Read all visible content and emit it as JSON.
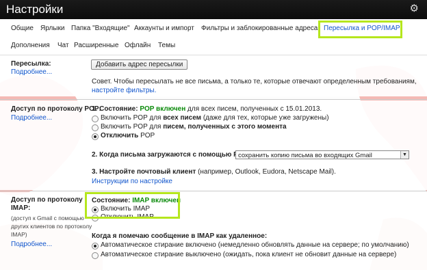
{
  "header": {
    "title": "Настройки",
    "gear_icon": "gear-icon"
  },
  "tabs": [
    {
      "label": "Общие"
    },
    {
      "label": "Ярлыки"
    },
    {
      "label": "Папка \"Входящие\""
    },
    {
      "label": "Аккаунты и импорт"
    },
    {
      "label": "Фильтры и заблокированные адреса"
    },
    {
      "label": "Пересылка и POP/IMAP"
    },
    {
      "label": "Дополнения"
    },
    {
      "label": "Чат"
    },
    {
      "label": "Расширенные"
    },
    {
      "label": "Офлайн"
    },
    {
      "label": "Темы"
    }
  ],
  "forwarding": {
    "label": "Пересылка:",
    "more": "Подробнее...",
    "add_button": "Добавить адрес пересылки",
    "tip": "Совет. Чтобы пересылать не все письма, а только те, которые отвечают определенным требованиям,",
    "tip_link": "настройте фильтры."
  },
  "pop": {
    "label": "Доступ по протоколу POP:",
    "more": "Подробнее...",
    "status_prefix": "1. Состояние:",
    "status_value": "POP включен",
    "status_suffix": "для всех писем, полученных с 15.01.2013.",
    "opt1_a": "Включить POP для",
    "opt1_b": "всех писем",
    "opt1_c": "(даже для тех, которые уже загружены)",
    "opt2_a": "Включить POP для",
    "opt2_b": "писем, полученных с этого момента",
    "opt3_a": "Отключить",
    "opt3_b": "POP",
    "q2": "2. Когда письма загружаются с помощью POP",
    "q2_select": "сохранить копию письма во входящих Gmail",
    "q3_a": "3. Настройте почтовый клиент",
    "q3_b": "(например, Outlook, Eudora, Netscape Mail).",
    "instructions": "Инструкции по настройке"
  },
  "imap": {
    "label_1": "Доступ по протоколу",
    "label_2": "IMAP:",
    "desc_1": "(доступ к Gmail с помощью",
    "desc_2": "других клиентов по протоколу",
    "desc_3": "IMAP)",
    "more": "Подробнее...",
    "status_prefix": "Состояние:",
    "status_value": "IMAP включен",
    "opt_on": "Включить IMAP",
    "opt_off": "Отключить IMAP",
    "q": "Когда я помечаю сообщение в IMAP как удаленное:",
    "auto_on": "Автоматическое стирание включено (немедленно обновлять данные на сервере; по умолчанию)",
    "auto_off": "Автоматическое стирание выключено (ожидать, пока клиент не обновит данные на сервере)"
  },
  "colors": {
    "highlight": "#b5e61d",
    "link": "#1155cc",
    "status_green": "#0a8a0a"
  }
}
